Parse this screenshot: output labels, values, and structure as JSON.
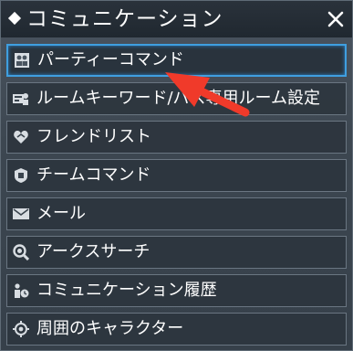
{
  "header": {
    "title": "コミュニケーション",
    "diamond_icon": "diamond-icon",
    "close_icon": "close-icon"
  },
  "menu": {
    "items": [
      {
        "label": "パーティーコマンド",
        "icon": "party-icon",
        "selected": true
      },
      {
        "label": "ルームキーワード/パス専用ルーム設定",
        "icon": "room-keyword-icon",
        "selected": false
      },
      {
        "label": "フレンドリスト",
        "icon": "friend-list-icon",
        "selected": false
      },
      {
        "label": "チームコマンド",
        "icon": "team-icon",
        "selected": false
      },
      {
        "label": "メール",
        "icon": "mail-icon",
        "selected": false
      },
      {
        "label": "アークスサーチ",
        "icon": "search-icon",
        "selected": false
      },
      {
        "label": "コミュニケーション履歴",
        "icon": "history-icon",
        "selected": false
      },
      {
        "label": "周囲のキャラクター",
        "icon": "nearby-characters-icon",
        "selected": false
      }
    ]
  },
  "colors": {
    "accent": "#3f9fe0",
    "annotation_arrow": "#f03a2a"
  }
}
